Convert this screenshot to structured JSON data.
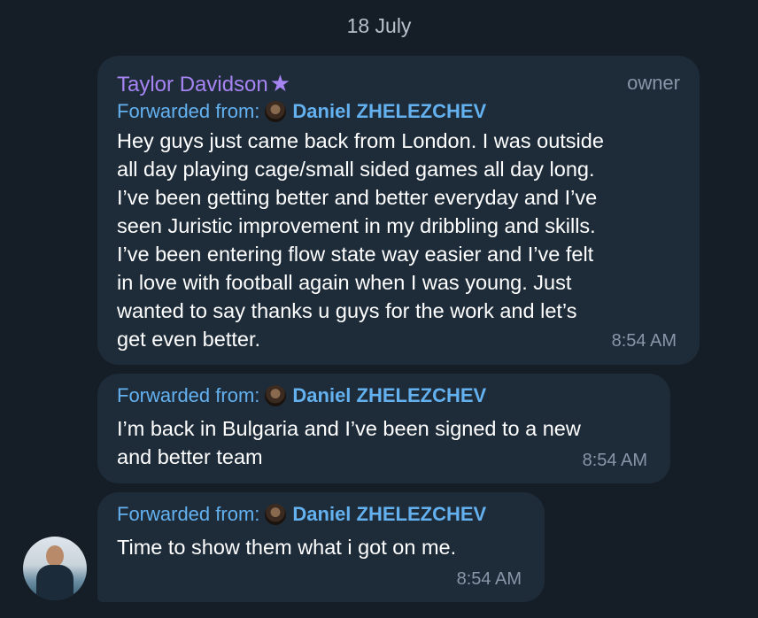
{
  "chat": {
    "date_separator": "18 July",
    "messages": [
      {
        "sender": "Taylor Davidson",
        "role": "owner",
        "forward_prefix": "Forwarded from:",
        "forward_name": "Daniel ZHELEZCHEV",
        "lines": [
          "Hey guys just came back from London. I was outside",
          "all day playing cage/small sided games all day long.",
          "I’ve been getting better and better everyday and I’ve",
          "seen Juristic improvement in my dribbling and skills.",
          "I’ve been entering flow state way easier and I’ve felt",
          "in love with football again when I was young. Just",
          "wanted to say thanks u guys for the work and let’s",
          "get even better."
        ],
        "time": "8:54 AM"
      },
      {
        "forward_prefix": "Forwarded from:",
        "forward_name": "Daniel ZHELEZCHEV",
        "lines": [
          "I’m back in Bulgaria and I’ve been signed to a new",
          "and better team"
        ],
        "time": "8:54 AM"
      },
      {
        "forward_prefix": "Forwarded from:",
        "forward_name": "Daniel ZHELEZCHEV",
        "lines": [
          "Time to show them what i got on me."
        ],
        "time": "8:54 AM"
      }
    ]
  },
  "icons": {
    "sender_badge": "star-icon",
    "forward_avatar": "forwarded-user-avatar",
    "sender_avatar": "sender-avatar"
  },
  "colors": {
    "background": "#151d26",
    "bubble": "#1e2c3a",
    "sender_name": "#a684f2",
    "link": "#64b1f0",
    "meta": "#8796a8"
  }
}
